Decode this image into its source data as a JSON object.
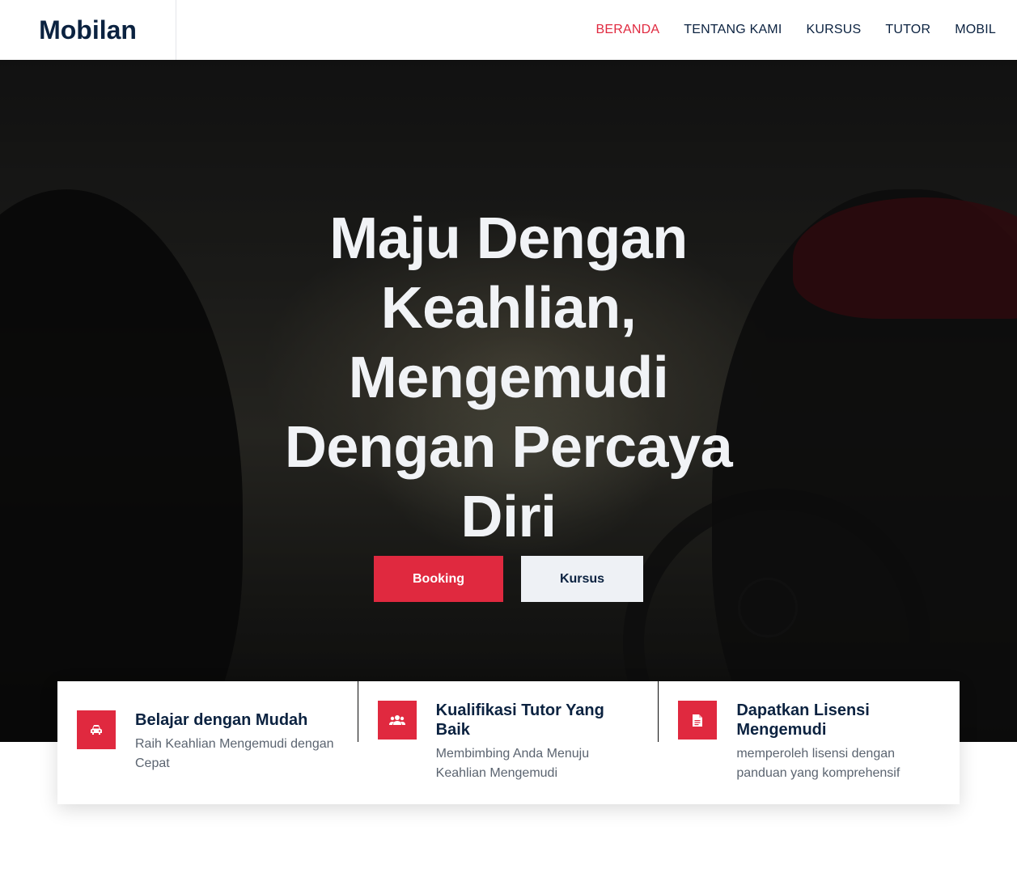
{
  "navbar": {
    "brand": "Mobilan",
    "links": [
      {
        "label": "BERANDA",
        "active": true
      },
      {
        "label": "TENTANG KAMI",
        "active": false
      },
      {
        "label": "KURSUS",
        "active": false
      },
      {
        "label": "TUTOR",
        "active": false
      },
      {
        "label": "MOBIL",
        "active": false
      }
    ]
  },
  "hero": {
    "title_lines": [
      "Maju Dengan",
      "Keahlian,",
      "Mengemudi",
      "Dengan Percaya",
      "Diri"
    ],
    "primary_button": "Booking",
    "secondary_button": "Kursus"
  },
  "features": [
    {
      "icon": "car-icon",
      "title": "Belajar dengan Mudah",
      "description": "Raih Keahlian Mengemudi dengan Cepat"
    },
    {
      "icon": "users-icon",
      "title": "Kualifikasi Tutor Yang Baik",
      "description": "Membimbing Anda Menuju Keahlian Mengemudi"
    },
    {
      "icon": "document-icon",
      "title": "Dapatkan Lisensi Mengemudi",
      "description": "memperoleh lisensi dengan panduan yang komprehensif"
    }
  ],
  "colors": {
    "accent": "#e0293f",
    "navy": "#0b2240",
    "light_button": "#eef1f5"
  }
}
